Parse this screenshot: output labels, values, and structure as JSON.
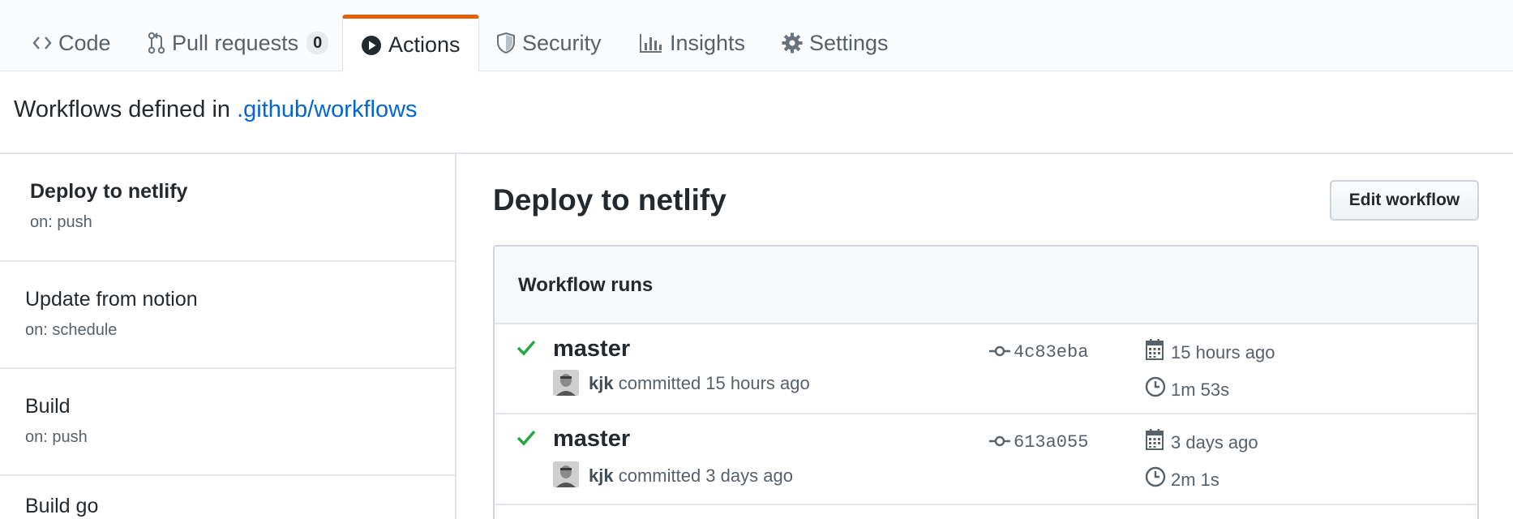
{
  "tabs": [
    {
      "label": "Code",
      "icon": "code-icon"
    },
    {
      "label": "Pull requests",
      "icon": "pull-request-icon",
      "count": "0"
    },
    {
      "label": "Actions",
      "icon": "play-icon",
      "selected": true
    },
    {
      "label": "Security",
      "icon": "shield-icon"
    },
    {
      "label": "Insights",
      "icon": "graph-icon"
    },
    {
      "label": "Settings",
      "icon": "gear-icon"
    }
  ],
  "workflows_line": {
    "prefix": "Workflows defined in ",
    "link": ".github/workflows"
  },
  "sidebar": {
    "items": [
      {
        "name": "Deploy to netlify",
        "trigger": "on: push",
        "active": true
      },
      {
        "name": "Update from notion",
        "trigger": "on: schedule"
      },
      {
        "name": "Build",
        "trigger": "on: push"
      },
      {
        "name": "Build go",
        "trigger": ""
      }
    ]
  },
  "main": {
    "title": "Deploy to netlify",
    "edit_button": "Edit workflow",
    "runs_header": "Workflow runs",
    "runs": [
      {
        "branch": "master",
        "author": "kjk",
        "commit_text": " committed 15 hours ago",
        "sha": "4c83eba",
        "date": "15 hours ago",
        "duration": "1m 53s",
        "status": "success"
      },
      {
        "branch": "master",
        "author": "kjk",
        "commit_text": " committed 3 days ago",
        "sha": "613a055",
        "date": "3 days ago",
        "duration": "2m 1s",
        "status": "success"
      }
    ]
  },
  "colors": {
    "accent": "#e36209",
    "link": "#0366d6",
    "success": "#28a745"
  }
}
